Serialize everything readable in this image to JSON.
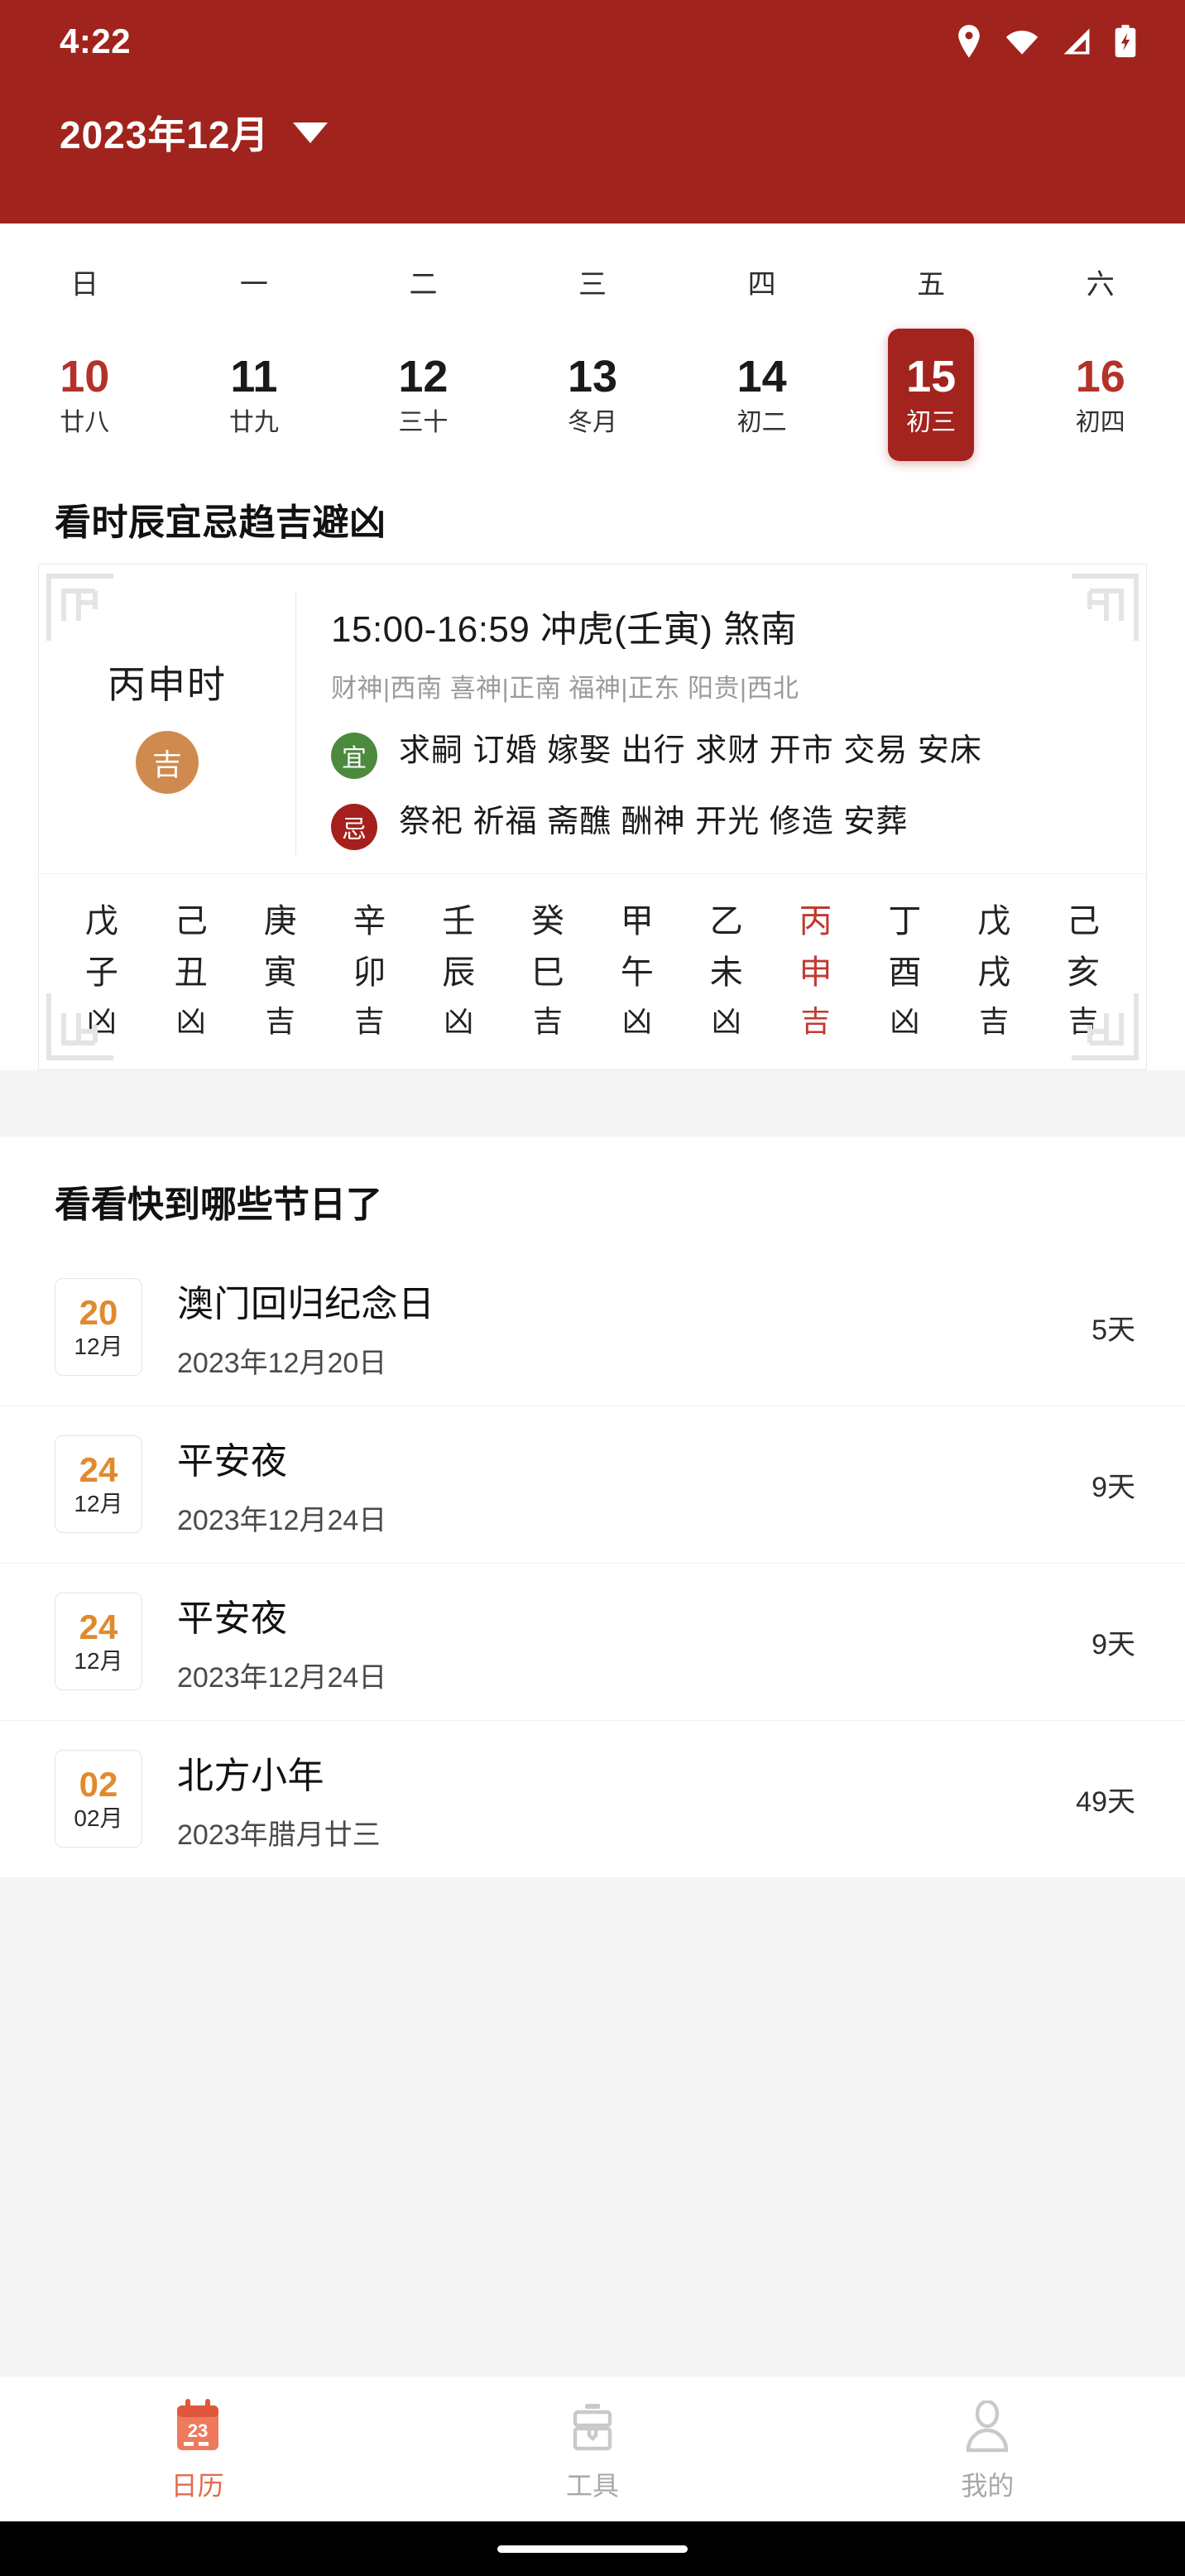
{
  "status_bar": {
    "time": "4:22",
    "icons": [
      "location-pin-icon",
      "wifi-icon",
      "cellular-signal-icon",
      "battery-charging-icon"
    ]
  },
  "header": {
    "month_title": "2023年12月",
    "dropdown_icon": "chevron-down-icon",
    "background_color": "#A0241D"
  },
  "calendar": {
    "weekday_labels": [
      "日",
      "一",
      "二",
      "三",
      "四",
      "五",
      "六"
    ],
    "days": [
      {
        "num": "10",
        "lunar": "廿八",
        "weekend": true,
        "selected": false
      },
      {
        "num": "11",
        "lunar": "廿九",
        "weekend": false,
        "selected": false
      },
      {
        "num": "12",
        "lunar": "三十",
        "weekend": false,
        "selected": false
      },
      {
        "num": "13",
        "lunar": "冬月",
        "weekend": false,
        "selected": false
      },
      {
        "num": "14",
        "lunar": "初二",
        "weekend": false,
        "selected": false
      },
      {
        "num": "15",
        "lunar": "初三",
        "weekend": false,
        "selected": true
      },
      {
        "num": "16",
        "lunar": "初四",
        "weekend": true,
        "selected": false
      }
    ],
    "selected_color": "#A3231E",
    "weekend_color": "#B4322A"
  },
  "fortune": {
    "section_title": "看时辰宜忌趋吉避凶",
    "shichen": "丙申时",
    "luck_badge": "吉",
    "luck_badge_color": "#D08A4E",
    "time_range": "15:00-16:59",
    "clash": "冲虎(壬寅)",
    "sha": "煞南",
    "time_line": "15:00-16:59  冲虎(壬寅) 煞南",
    "gods": "财神|西南 喜神|正南 福神|正东 阳贵|西北",
    "yi_badge": "宜",
    "yi_badge_color": "#4C8A3E",
    "yi_items": "求嗣 订婚 嫁娶 出行 求财 开市 交易 安床",
    "ji_badge": "忌",
    "ji_badge_color": "#A5201C",
    "ji_items": "祭祀 祈福 斋醮 酬神 开光 修造 安葬",
    "branches": {
      "stems": [
        "戊",
        "己",
        "庚",
        "辛",
        "壬",
        "癸",
        "甲",
        "乙",
        "丙",
        "丁",
        "戊",
        "己"
      ],
      "branch": [
        "子",
        "丑",
        "寅",
        "卯",
        "辰",
        "巳",
        "午",
        "未",
        "申",
        "酉",
        "戌",
        "亥"
      ],
      "luck": [
        "凶",
        "凶",
        "吉",
        "吉",
        "凶",
        "吉",
        "凶",
        "凶",
        "吉",
        "凶",
        "吉",
        "吉"
      ],
      "highlight_index": 8,
      "highlight_color": "#C03A2F"
    }
  },
  "holidays": {
    "section_title": "看看快到哪些节日了",
    "rows": [
      {
        "day": "20",
        "month": "12月",
        "name": "澳门回归纪念日",
        "date": "2023年12月20日",
        "countdown": "5天"
      },
      {
        "day": "24",
        "month": "12月",
        "name": "平安夜",
        "date": "2023年12月24日",
        "countdown": "9天"
      },
      {
        "day": "24",
        "month": "12月",
        "name": "平安夜",
        "date": "2023年12月24日",
        "countdown": "9天"
      },
      {
        "day": "02",
        "month": "02月",
        "name": "北方小年",
        "date": "2023年腊月廿三",
        "countdown": "49天"
      }
    ],
    "day_color": "#E08A2E"
  },
  "tabbar": {
    "tabs": [
      {
        "label": "日历",
        "icon": "calendar-icon",
        "active": true
      },
      {
        "label": "工具",
        "icon": "toolbox-icon",
        "active": false
      },
      {
        "label": "我的",
        "icon": "person-icon",
        "active": false
      }
    ],
    "active_color": "#E26A4E",
    "inactive_color": "#A8A8A8"
  }
}
